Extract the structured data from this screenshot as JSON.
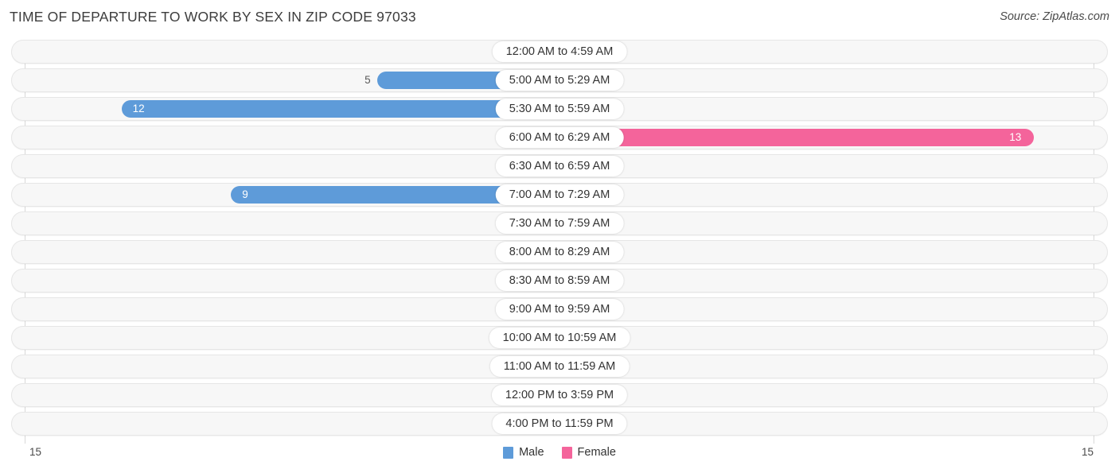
{
  "header": {
    "title": "TIME OF DEPARTURE TO WORK BY SEX IN ZIP CODE 97033",
    "source": "Source: ZipAtlas.com"
  },
  "legend": {
    "male_label": "Male",
    "female_label": "Female",
    "male_color": "#5e9bd9",
    "female_color": "#f4649b"
  },
  "axis": {
    "left_max_label": "15",
    "right_max_label": "15"
  },
  "colors": {
    "male_strong": "#5e9bd9",
    "male_faint": "#aecbec",
    "female_strong": "#f4649b",
    "female_faint": "#f9a8c4",
    "track": "#f7f7f7",
    "track_border": "#e6e6e6"
  },
  "chart_data": {
    "type": "bar",
    "title": "TIME OF DEPARTURE TO WORK BY SEX IN ZIP CODE 97033",
    "subtitle": "Source: ZipAtlas.com",
    "orientation": "horizontal-diverging",
    "xlabel": "",
    "ylabel": "",
    "xlim": [
      15,
      15
    ],
    "grid": false,
    "legend_position": "bottom-center",
    "categories": [
      "12:00 AM to 4:59 AM",
      "5:00 AM to 5:29 AM",
      "5:30 AM to 5:59 AM",
      "6:00 AM to 6:29 AM",
      "6:30 AM to 6:59 AM",
      "7:00 AM to 7:29 AM",
      "7:30 AM to 7:59 AM",
      "8:00 AM to 8:29 AM",
      "8:30 AM to 8:59 AM",
      "9:00 AM to 9:59 AM",
      "10:00 AM to 10:59 AM",
      "11:00 AM to 11:59 AM",
      "12:00 PM to 3:59 PM",
      "4:00 PM to 11:59 PM"
    ],
    "series": [
      {
        "name": "Male",
        "color": "#5e9bd9",
        "values": [
          0,
          5,
          12,
          0,
          0,
          9,
          0,
          0,
          0,
          0,
          0,
          0,
          0,
          0
        ]
      },
      {
        "name": "Female",
        "color": "#f4649b",
        "values": [
          0,
          0,
          0,
          13,
          0,
          0,
          0,
          0,
          0,
          0,
          0,
          0,
          0,
          0
        ]
      }
    ]
  },
  "rows": [
    {
      "label": "12:00 AM to 4:59 AM",
      "male": "0",
      "female": "0"
    },
    {
      "label": "5:00 AM to 5:29 AM",
      "male": "5",
      "female": "0"
    },
    {
      "label": "5:30 AM to 5:59 AM",
      "male": "12",
      "female": "0"
    },
    {
      "label": "6:00 AM to 6:29 AM",
      "male": "0",
      "female": "13"
    },
    {
      "label": "6:30 AM to 6:59 AM",
      "male": "0",
      "female": "0"
    },
    {
      "label": "7:00 AM to 7:29 AM",
      "male": "9",
      "female": "0"
    },
    {
      "label": "7:30 AM to 7:59 AM",
      "male": "0",
      "female": "0"
    },
    {
      "label": "8:00 AM to 8:29 AM",
      "male": "0",
      "female": "0"
    },
    {
      "label": "8:30 AM to 8:59 AM",
      "male": "0",
      "female": "0"
    },
    {
      "label": "9:00 AM to 9:59 AM",
      "male": "0",
      "female": "0"
    },
    {
      "label": "10:00 AM to 10:59 AM",
      "male": "0",
      "female": "0"
    },
    {
      "label": "11:00 AM to 11:59 AM",
      "male": "0",
      "female": "0"
    },
    {
      "label": "12:00 PM to 3:59 PM",
      "male": "0",
      "female": "0"
    },
    {
      "label": "4:00 PM to 11:59 PM",
      "male": "0",
      "female": "0"
    }
  ]
}
